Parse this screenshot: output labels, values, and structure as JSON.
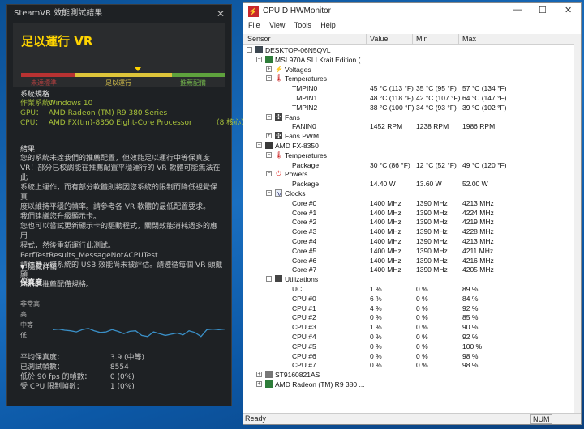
{
  "steamvr": {
    "title": "SteamVR 效能測試結果",
    "result": "足以運行 VR",
    "meter_labels": [
      "未達標準",
      "足以運行",
      "推薦配備"
    ],
    "meter_level": 0.58,
    "specs_title": "系統規格",
    "specs": [
      {
        "k": "作業系統：",
        "v": "Windows 10",
        "n": ""
      },
      {
        "k": "GPU：",
        "v": "AMD Radeon (TM) R9 380 Series",
        "n": ""
      },
      {
        "k": "CPU：",
        "v": "AMD FX(tm)-8350 Eight-Core Processor",
        "n": "（8 核心）"
      }
    ],
    "conclusion_title": "結果",
    "conclusion_text": "您的系統未達我們的推薦配置，但效能足以運行中等保真度\nVR！部分已校調能在推薦配置平穩運行的 VR 軟體可能無法在此\n系統上運作，而有部分軟體則將因您系統的限制而降低視覺保真\n度以維持平穩的幀率。請參考各 VR 軟體的最低配置要求。\n我們建議您升級顯示卡。\n您也可以嘗試更新顯示卡的驅動程式，關閉效能消耗過多的應用\n程式，然後重新運行此測試。\nPerfTestResults_MessageNotACPUTest\n請注意，您系統的 USB 效能尚未被評估。請遵循每個 VR 頭戴顯\n示器的推薦配備規格。",
    "details_title": "隱藏詳情",
    "fidelity_title": "保真度",
    "fidelity_levels": [
      "非常高",
      "高",
      "中等",
      "低"
    ],
    "stats": [
      {
        "k": "平均保真度：",
        "v": "3.9 (中等)"
      },
      {
        "k": "已測試幀數：",
        "v": "8554"
      },
      {
        "k": "低於 90 fps 的幀數：",
        "v": "0 (0%)"
      },
      {
        "k": "受 CPU 限制幀數：",
        "v": "1 (0%)"
      }
    ],
    "chart_data": {
      "type": "line",
      "title": "",
      "xlabel": "",
      "ylabel": "",
      "y_categories": [
        "低",
        "中等",
        "高",
        "非常高"
      ],
      "x": [
        0,
        1,
        2,
        3,
        4,
        5,
        6,
        7,
        8,
        9,
        10,
        11,
        12,
        13,
        14,
        15,
        16,
        17,
        18,
        19,
        20,
        21,
        22,
        23,
        24,
        25,
        26,
        27,
        28,
        29
      ],
      "values": [
        2.1,
        2.15,
        2.05,
        2.0,
        1.9,
        2.1,
        2.2,
        2.0,
        1.85,
        1.9,
        2.1,
        1.95,
        1.75,
        1.95,
        2.0,
        1.6,
        1.5,
        1.9,
        1.75,
        1.6,
        1.7,
        1.8,
        1.65,
        2.0,
        1.85,
        1.5,
        2.1,
        2.15,
        2.1,
        2.15
      ],
      "ylim": [
        0.5,
        4.3
      ],
      "color": "#3a90c8"
    }
  },
  "hwmonitor": {
    "title": "CPUID HWMonitor",
    "menu": [
      "File",
      "View",
      "Tools",
      "Help"
    ],
    "columns": [
      "Sensor",
      "Value",
      "Min",
      "Max"
    ],
    "rows": [
      {
        "level": 0,
        "exp": "−",
        "icon": "pc-icon",
        "cls": "ic-pc",
        "name": "DESKTOP-06N5QVL"
      },
      {
        "level": 1,
        "exp": "−",
        "icon": "motherboard-icon",
        "cls": "ic-board",
        "name": "MSI 970A SLI Krait Edition (..."
      },
      {
        "level": 2,
        "exp": "+",
        "icon": "voltage-icon",
        "cls": "ic-volt",
        "glyph": "⚡",
        "name": "Voltages"
      },
      {
        "level": 2,
        "exp": "−",
        "icon": "thermometer-icon",
        "cls": "ic-temp",
        "glyph": "🌡",
        "name": "Temperatures"
      },
      {
        "level": 3,
        "name": "TMPIN0",
        "value": "45 °C  (113 °F)",
        "min": "35 °C  (95 °F)",
        "max": "57 °C  (134 °F)"
      },
      {
        "level": 3,
        "name": "TMPIN1",
        "value": "48 °C  (118 °F)",
        "min": "42 °C  (107 °F)",
        "max": "64 °C  (147 °F)"
      },
      {
        "level": 3,
        "name": "TMPIN2",
        "value": "38 °C  (100 °F)",
        "min": "34 °C  (93 °F)",
        "max": "39 °C  (102 °F)"
      },
      {
        "level": 2,
        "exp": "−",
        "icon": "fan-icon",
        "cls": "ic-fan",
        "glyph": "✣",
        "name": "Fans"
      },
      {
        "level": 3,
        "name": "FANIN0",
        "value": "1452 RPM",
        "min": "1238 RPM",
        "max": "1986 RPM"
      },
      {
        "level": 2,
        "exp": "+",
        "icon": "fan-icon",
        "cls": "ic-fan",
        "glyph": "✣",
        "name": "Fans PWM"
      },
      {
        "level": 1,
        "exp": "−",
        "icon": "cpu-icon",
        "cls": "ic-cpu",
        "name": "AMD FX-8350"
      },
      {
        "level": 2,
        "exp": "−",
        "icon": "thermometer-icon",
        "cls": "ic-temp",
        "glyph": "🌡",
        "name": "Temperatures"
      },
      {
        "level": 3,
        "name": "Package",
        "value": "30 °C  (86 °F)",
        "min": "12 °C  (52 °F)",
        "max": "49 °C  (120 °F)"
      },
      {
        "level": 2,
        "exp": "−",
        "icon": "power-icon",
        "cls": "ic-power",
        "glyph": "⏻",
        "name": "Powers"
      },
      {
        "level": 3,
        "name": "Package",
        "value": "14.40 W",
        "min": "13.60 W",
        "max": "52.00 W"
      },
      {
        "level": 2,
        "exp": "−",
        "icon": "clock-icon",
        "cls": "ic-clock",
        "glyph": "∿",
        "name": "Clocks"
      },
      {
        "level": 3,
        "name": "Core #0",
        "value": "1400 MHz",
        "min": "1390 MHz",
        "max": "4213 MHz"
      },
      {
        "level": 3,
        "name": "Core #1",
        "value": "1400 MHz",
        "min": "1390 MHz",
        "max": "4224 MHz"
      },
      {
        "level": 3,
        "name": "Core #2",
        "value": "1400 MHz",
        "min": "1390 MHz",
        "max": "4219 MHz"
      },
      {
        "level": 3,
        "name": "Core #3",
        "value": "1400 MHz",
        "min": "1390 MHz",
        "max": "4228 MHz"
      },
      {
        "level": 3,
        "name": "Core #4",
        "value": "1400 MHz",
        "min": "1390 MHz",
        "max": "4213 MHz"
      },
      {
        "level": 3,
        "name": "Core #5",
        "value": "1400 MHz",
        "min": "1390 MHz",
        "max": "4211 MHz"
      },
      {
        "level": 3,
        "name": "Core #6",
        "value": "1400 MHz",
        "min": "1390 MHz",
        "max": "4216 MHz"
      },
      {
        "level": 3,
        "name": "Core #7",
        "value": "1400 MHz",
        "min": "1390 MHz",
        "max": "4205 MHz"
      },
      {
        "level": 2,
        "exp": "−",
        "icon": "utilization-icon",
        "cls": "ic-util",
        "name": "Utilizations"
      },
      {
        "level": 3,
        "name": "UC",
        "value": "1 %",
        "min": "0 %",
        "max": "89 %"
      },
      {
        "level": 3,
        "name": "CPU #0",
        "value": "6 %",
        "min": "0 %",
        "max": "84 %"
      },
      {
        "level": 3,
        "name": "CPU #1",
        "value": "4 %",
        "min": "0 %",
        "max": "92 %"
      },
      {
        "level": 3,
        "name": "CPU #2",
        "value": "0 %",
        "min": "0 %",
        "max": "85 %"
      },
      {
        "level": 3,
        "name": "CPU #3",
        "value": "1 %",
        "min": "0 %",
        "max": "90 %"
      },
      {
        "level": 3,
        "name": "CPU #4",
        "value": "0 %",
        "min": "0 %",
        "max": "92 %"
      },
      {
        "level": 3,
        "name": "CPU #5",
        "value": "0 %",
        "min": "0 %",
        "max": "100 %"
      },
      {
        "level": 3,
        "name": "CPU #6",
        "value": "0 %",
        "min": "0 %",
        "max": "98 %"
      },
      {
        "level": 3,
        "name": "CPU #7",
        "value": "0 %",
        "min": "0 %",
        "max": "98 %"
      },
      {
        "level": 1,
        "exp": "+",
        "icon": "disk-icon",
        "cls": "ic-disk",
        "name": "ST9160821AS"
      },
      {
        "level": 1,
        "exp": "+",
        "icon": "gpu-icon",
        "cls": "ic-gpu",
        "name": "AMD Radeon (TM) R9 380 ..."
      }
    ],
    "status": "Ready",
    "num_indicator": "NUM"
  }
}
